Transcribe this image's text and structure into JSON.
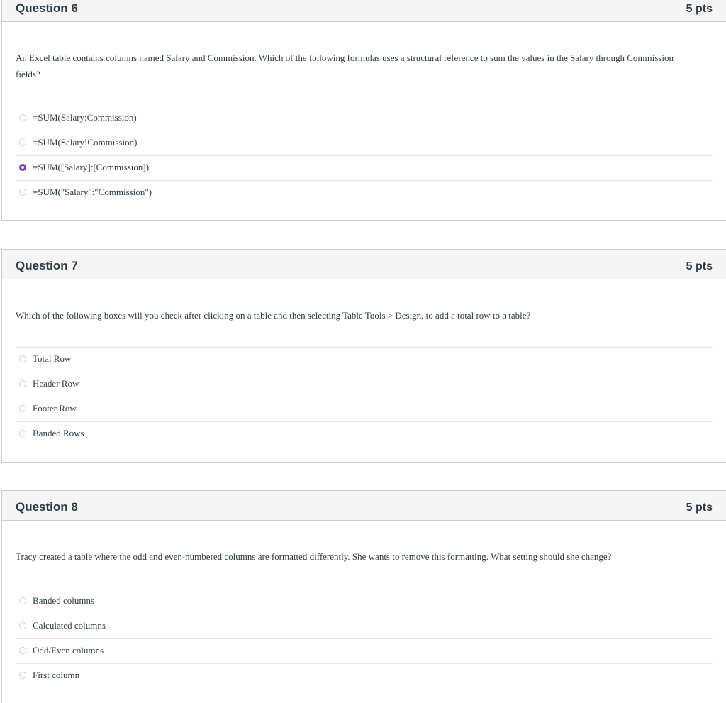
{
  "questions": [
    {
      "title": "Question 6",
      "points": "5 pts",
      "text": "An Excel table contains columns named Salary and Commission. Which of the following formulas uses a structural reference to sum the values in the Salary through Commission fields?",
      "answers": [
        {
          "label": "=SUM(Salary:Commission)",
          "selected": false
        },
        {
          "label": "=SUM(Salary!Commission)",
          "selected": false
        },
        {
          "label": "=SUM([Salary]:[Commission])",
          "selected": true
        },
        {
          "label": "=SUM(\"Salary\":\"Commission\")",
          "selected": false
        }
      ]
    },
    {
      "title": "Question 7",
      "points": "5 pts",
      "text": "Which of the following boxes will you check after clicking on a table and then selecting Table Tools > Design, to add a total row to a table?",
      "answers": [
        {
          "label": "Total Row",
          "selected": false
        },
        {
          "label": "Header Row",
          "selected": false
        },
        {
          "label": "Footer Row",
          "selected": false
        },
        {
          "label": "Banded Rows",
          "selected": false
        }
      ]
    },
    {
      "title": "Question 8",
      "points": "5 pts",
      "text": "Tracy created a table where the odd and even-numbered columns are formatted differently. She wants to remove this formatting. What setting should she change?",
      "answers": [
        {
          "label": "Banded columns",
          "selected": false
        },
        {
          "label": "Calculated columns",
          "selected": false
        },
        {
          "label": "Odd/Even columns",
          "selected": false
        },
        {
          "label": "First column",
          "selected": false
        }
      ]
    }
  ],
  "colors": {
    "accent": "#7b3fa0",
    "header_bg": "#f5f5f5",
    "border": "#c7cdd1",
    "text": "#2d3b45"
  }
}
